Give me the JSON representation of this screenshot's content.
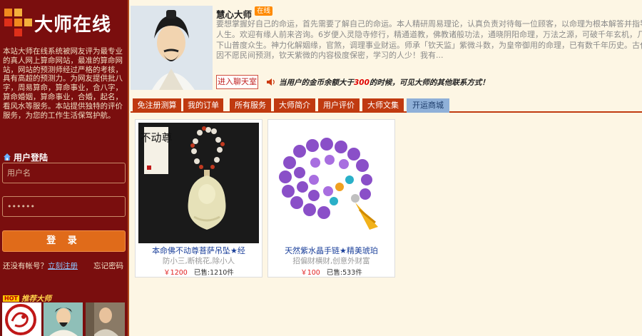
{
  "sidebar": {
    "logo_text": "大师在线",
    "intro": "本站大师在线系统被网友评为最专业的真人网上算命网站，最准的算命网站，网站的预测师经过严格的考核，具有高超的预测力。为网友提供批八字，周易算命，算命事业，合八字，算命婚姻，算命事业，合婚，起名，看风水等服务。本站提供独特的评价服务，为您的工作生活保驾护航。",
    "login_title": "用户登陆",
    "username_placeholder": "用户名",
    "password_mask": "••••••",
    "login_button": "登 录",
    "no_account": "还没有帐号？",
    "register_link": "立刻注册",
    "forgot_password": "忘记密码",
    "recommend_badge": "HOT",
    "recommend_title": "推荐大师"
  },
  "master": {
    "name": "慧心大师",
    "status": "在线",
    "description_lines": [
      "要想掌握好自己的命运，首先需要了解自己的命运。本人精研周易理论，认真负责对待每一位顾客，以命理为根本解答并指导",
      "人生。欢迎有缘人前来咨询。6岁便入灵隐寺修行，精通道教，佛教诸般功法，通晓阴阳命理，万法之源，可破千年玄机，几十年",
      "下山普度众生。神力化解姻缘，官煞，调理事业财运。师承「钦天监」紫微斗数，为皇帝御用的命理，已有数千年历史。古代",
      "因不愿民间预测，钦天紫微的内容极度保密，学习的人少！我有..."
    ],
    "chat_button": "进入聊天室",
    "notice_prefix": "当用户的金币余额大于",
    "notice_amount": "300",
    "notice_suffix": "的时候，可见大师的其他联系方式！"
  },
  "tabs": [
    {
      "label": "免注册测算"
    },
    {
      "label": "我的订单"
    },
    {
      "label": "所有服务"
    },
    {
      "label": "大师简介"
    },
    {
      "label": "用户评价"
    },
    {
      "label": "大师文集"
    },
    {
      "label": "开运商城",
      "active": true
    }
  ],
  "products": [
    {
      "title": "本命佛不动尊菩萨吊坠★经",
      "subtitle": "防小三,断桃花,除小人",
      "price": "￥1200",
      "sold": "已售:1210件",
      "image_caption": "不动尊"
    },
    {
      "title": "天然紫水晶手链★精美琥珀",
      "subtitle": "招偏财横财,创意外财富",
      "price": "￥100",
      "sold": "已售:533件"
    }
  ],
  "colors": {
    "sidebar_bg": "#7a0e0e",
    "tab_bg": "#c03a10",
    "tab_active_bg": "#8fb0d8",
    "login_button_bg": "#e06b1a",
    "price_red": "#e02020",
    "link_blue": "#1a3f9a",
    "page_bg": "#fdf6e4"
  }
}
